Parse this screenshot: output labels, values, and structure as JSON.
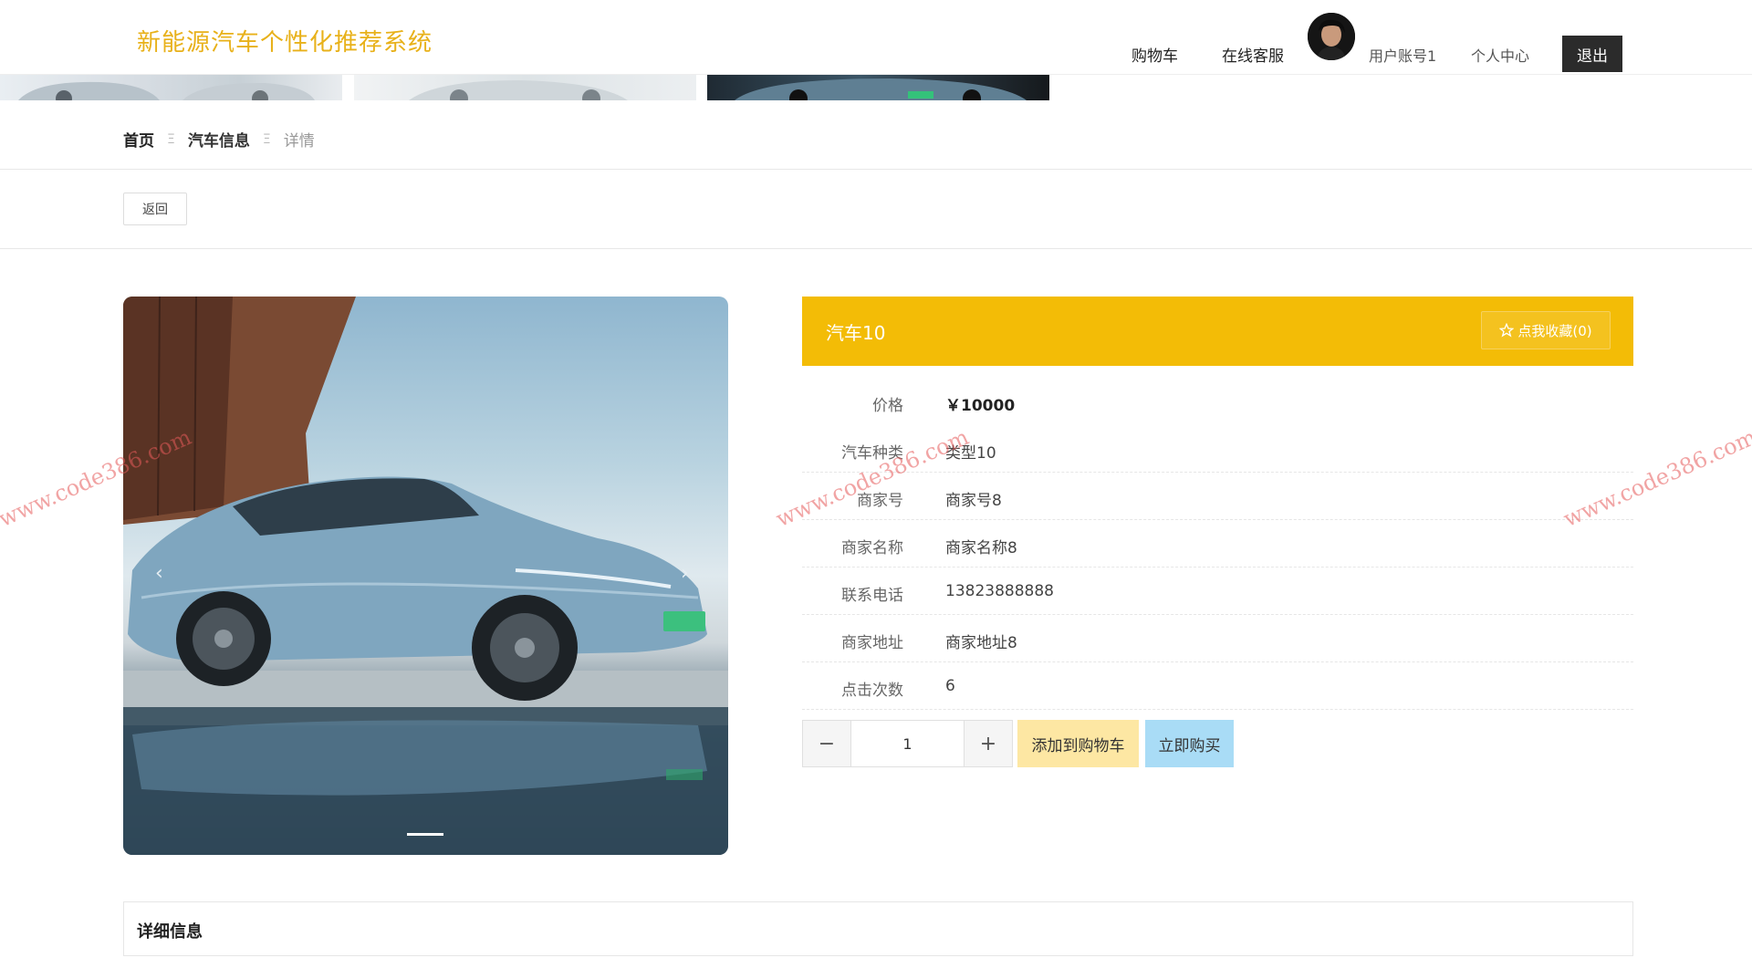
{
  "header": {
    "site_title": "新能源汽车个性化推荐系统",
    "nav": {
      "cart": "购物车",
      "service": "在线客服",
      "user": "用户账号1",
      "center": "个人中心",
      "logout": "退出"
    }
  },
  "breadcrumb": {
    "home": "首页",
    "category": "汽车信息",
    "current": "详情",
    "separator": "Ξ"
  },
  "back_label": "返回",
  "carousel": {
    "prev_symbol": "‹",
    "next_symbol": "›",
    "active_index": 0
  },
  "product": {
    "name": "汽车10",
    "fav_label": "点我收藏(0)",
    "fields": [
      {
        "label": "价格",
        "value": "￥10000"
      },
      {
        "label": "汽车种类",
        "value": "类型10"
      },
      {
        "label": "商家号",
        "value": "商家号8"
      },
      {
        "label": "商家名称",
        "value": "商家名称8"
      },
      {
        "label": "联系电话",
        "value": "13823888888"
      },
      {
        "label": "商家地址",
        "value": "商家地址8"
      },
      {
        "label": "点击次数",
        "value": "6"
      }
    ]
  },
  "quantity": {
    "minus": "−",
    "value": "1",
    "plus": "+"
  },
  "buttons": {
    "add_to_cart": "添加到购物车",
    "buy_now": "立即购买"
  },
  "detail": {
    "title": "详细信息"
  },
  "watermark": "www.code386.com",
  "colors": {
    "accent": "#f3bc06",
    "title": "#e8b11a",
    "add_cart_bg": "#fde7a3",
    "buy_bg": "#a9dcf6",
    "logout_bg": "#2b2b2b"
  }
}
